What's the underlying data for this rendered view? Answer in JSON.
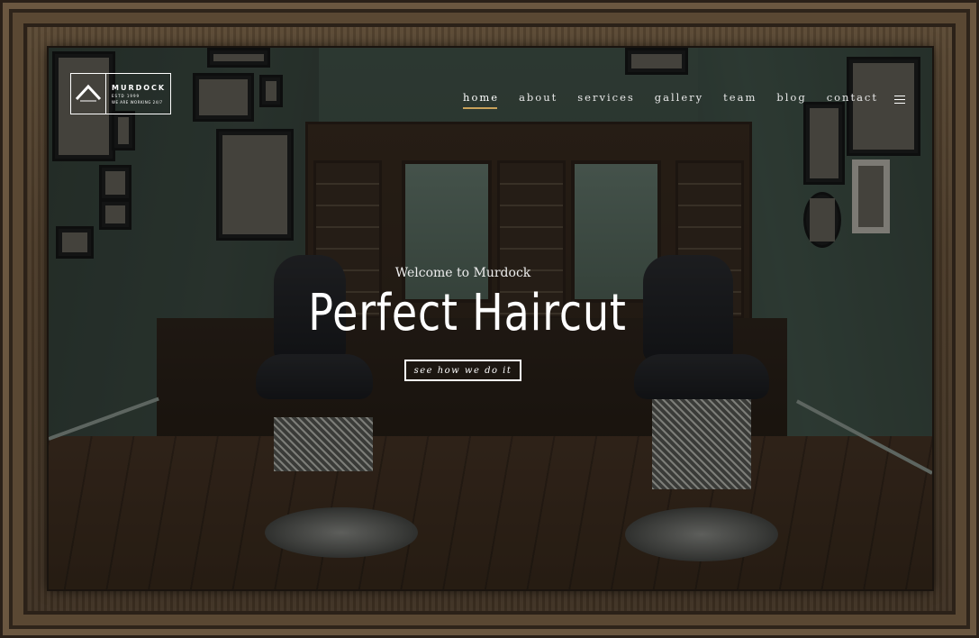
{
  "brand": {
    "name": "MURDOCK",
    "tagline_1": "ESTD 1999",
    "tagline_2": "WE ARE WORKING 24/7"
  },
  "nav": {
    "items": [
      {
        "label": "home",
        "active": true
      },
      {
        "label": "about"
      },
      {
        "label": "services"
      },
      {
        "label": "gallery"
      },
      {
        "label": "team"
      },
      {
        "label": "blog"
      },
      {
        "label": "contact"
      }
    ],
    "menu_icon": "hamburger-icon"
  },
  "hero": {
    "subtitle": "Welcome to Murdock",
    "title": "Perfect Haircut",
    "button_label": "see how we do it"
  },
  "colors": {
    "accent": "#c9a25a",
    "text": "#ffffff"
  }
}
